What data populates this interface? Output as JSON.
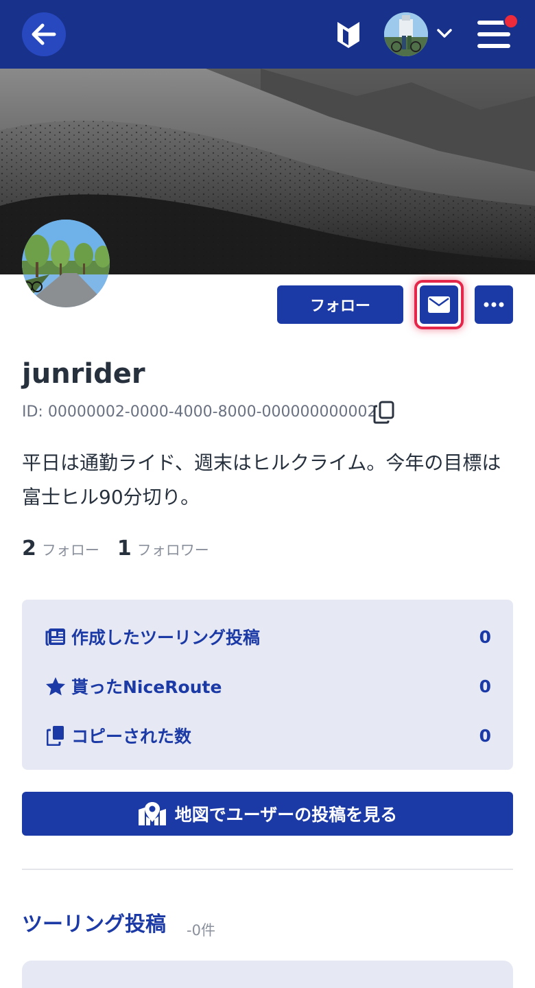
{
  "header": {
    "back_icon": "arrow-left-icon",
    "beginner_icon": "beginner-mark-icon",
    "avatar_icon": "user-avatar",
    "chevron_icon": "chevron-down-icon",
    "menu_icon": "hamburger-menu-icon",
    "notification_color": "#ee2b3b",
    "bar_color": "#18318a"
  },
  "profile": {
    "follow_label": "フォロー",
    "message_icon": "envelope-icon",
    "more_icon": "ellipsis-icon",
    "username": "junrider",
    "user_id": "ID: 00000002-0000-4000-8000-000000000002",
    "copy_icon": "copy-icon",
    "bio": "平日は通勤ライド、週末はヒルクライム。今年の目標は富士ヒル90分切り。",
    "following_count": "2",
    "following_label": "フォロー",
    "followers_count": "1",
    "followers_label": "フォロワー"
  },
  "summary": {
    "rows": [
      {
        "icon": "newspaper-icon",
        "label": "作成したツーリング投稿",
        "value": "0"
      },
      {
        "icon": "star-icon",
        "label": "貰ったNiceRoute",
        "value": "0"
      },
      {
        "icon": "copy-icon",
        "label": "コピーされた数",
        "value": "0"
      }
    ]
  },
  "map_button": {
    "icon": "map-marker-icon",
    "label": "地図でユーザーの投稿を見る"
  },
  "posts_section": {
    "title": "ツーリング投稿",
    "count": "-0件"
  },
  "colors": {
    "primary": "#1c3aa5",
    "highlight": "#e3264a",
    "card_bg": "#e6e9f4"
  }
}
